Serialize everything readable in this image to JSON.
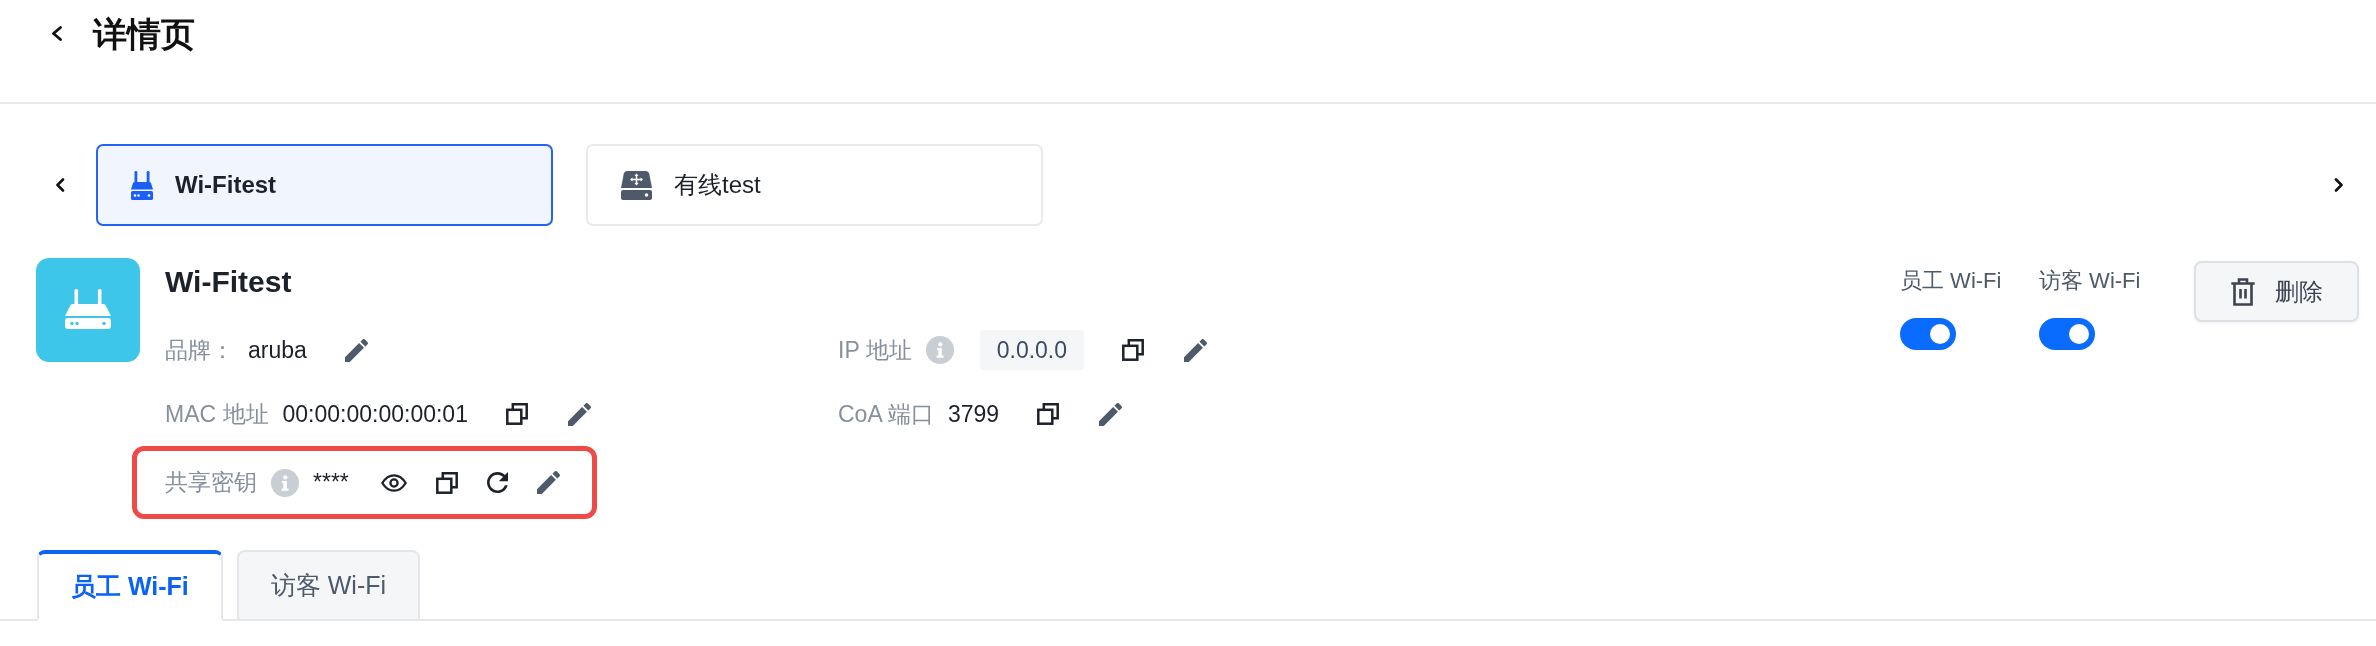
{
  "header": {
    "title": "详情页"
  },
  "device_tabs": [
    {
      "label": "Wi-Fitest",
      "kind": "wireless",
      "selected": true
    },
    {
      "label": "有线test",
      "kind": "wired",
      "selected": false
    }
  ],
  "device": {
    "name": "Wi-Fitest",
    "fields": [
      {
        "label": "品牌：",
        "value": "aruba",
        "info": false,
        "boxed": false,
        "highlighted": false,
        "actions": [
          {
            "kind": "edit"
          }
        ]
      },
      {
        "label": "IP 地址",
        "value": "0.0.0.0",
        "info": true,
        "boxed": true,
        "highlighted": false,
        "actions": [
          {
            "kind": "copy"
          },
          {
            "kind": "edit"
          }
        ]
      },
      {
        "label": "MAC 地址",
        "value": "00:00:00:00:00:01",
        "info": false,
        "boxed": false,
        "highlighted": false,
        "actions": [
          {
            "kind": "copy"
          },
          {
            "kind": "edit"
          }
        ]
      },
      {
        "label": "CoA 端口",
        "value": "3799",
        "info": false,
        "boxed": false,
        "highlighted": false,
        "actions": [
          {
            "kind": "copy"
          },
          {
            "kind": "edit"
          }
        ]
      },
      {
        "label": "共享密钥",
        "value": "****",
        "info": true,
        "boxed": false,
        "highlighted": true,
        "actions": [
          {
            "kind": "reveal"
          },
          {
            "kind": "copy"
          },
          {
            "kind": "regenerate"
          },
          {
            "kind": "edit"
          }
        ]
      }
    ]
  },
  "switches": [
    {
      "label": "员工 Wi-Fi",
      "on": true
    },
    {
      "label": "访客 Wi-Fi",
      "on": true
    }
  ],
  "delete_button": {
    "label": "删除"
  },
  "section_tabs": [
    {
      "label": "员工 Wi-Fi",
      "selected": true
    },
    {
      "label": "访客 Wi-Fi",
      "selected": false
    }
  ]
}
